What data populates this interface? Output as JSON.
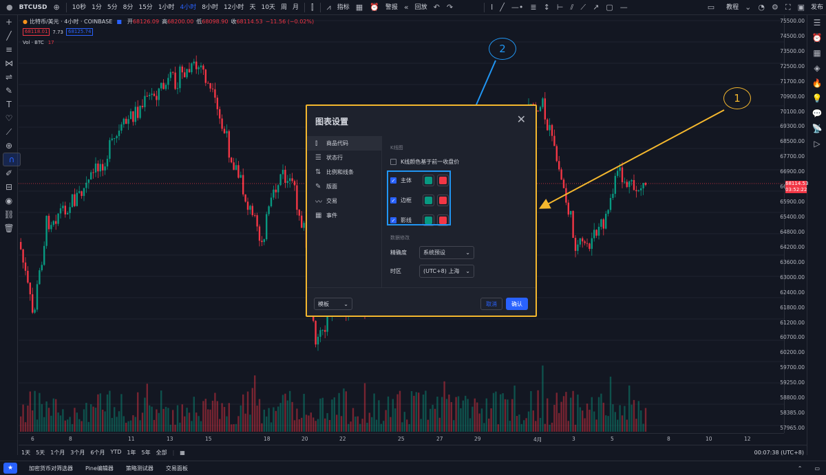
{
  "topbar": {
    "symbol": "BTCUSD",
    "intervals": [
      "10秒",
      "1分",
      "5分",
      "8分",
      "15分",
      "1小时",
      "4小时",
      "8小时",
      "12小时",
      "天",
      "10天",
      "周",
      "月"
    ],
    "active_interval": "4小时",
    "indicators_label": "指标",
    "alert_label": "警报",
    "replay_label": "回放",
    "tutorial_label": "教程",
    "publish_label": "发布"
  },
  "legend": {
    "title": "比特币/美元 · 4小时 · COINBASE",
    "open_label": "开",
    "open": "68126.09",
    "high_label": "高",
    "high": "68200.00",
    "low_label": "低",
    "low": "68098.90",
    "close_label": "收",
    "close": "68114.53",
    "change": "−11.56 (−0.02%)",
    "bid": "68118.01",
    "spread": "7.73",
    "ask": "68125.74",
    "volume_label": "Vol · BTC",
    "volume_value": "17"
  },
  "price_axis": {
    "labels": [
      "75500.00",
      "74500.00",
      "73500.00",
      "72500.00",
      "71700.00",
      "70900.00",
      "70100.00",
      "69300.00",
      "68500.00",
      "67700.00",
      "66900.00",
      "66400.00",
      "65900.00",
      "65400.00",
      "64800.00",
      "64200.00",
      "63600.00",
      "63000.00",
      "62400.00",
      "61800.00",
      "61200.00",
      "60700.00",
      "60200.00",
      "59700.00",
      "59250.00",
      "58800.00",
      "58385.00",
      "57965.00"
    ],
    "current_price": "68114.53",
    "countdown": "03:52:22"
  },
  "time_axis": {
    "labels": [
      "6",
      "8",
      "11",
      "13",
      "15",
      "18",
      "20",
      "22",
      "25",
      "27",
      "29",
      "4月",
      "3",
      "5",
      "8",
      "10",
      "12"
    ]
  },
  "range_bar": {
    "ranges": [
      "1天",
      "5天",
      "1个月",
      "3个月",
      "6个月",
      "YTD",
      "1年",
      "5年",
      "全部"
    ],
    "clock": "00:07:38 (UTC+8)"
  },
  "bottom_tabs": [
    "加密货币对筛选器",
    "Pine编辑器",
    "策略测试器",
    "交易面板"
  ],
  "dialog": {
    "title": "图表设置",
    "nav": [
      {
        "label": "商品代码",
        "icon": "candles-icon",
        "active": true
      },
      {
        "label": "状态行",
        "icon": "status-line-icon",
        "active": false
      },
      {
        "label": "比例和线条",
        "icon": "scales-icon",
        "active": false
      },
      {
        "label": "版面",
        "icon": "pencil-icon",
        "active": false
      },
      {
        "label": "交易",
        "icon": "trading-icon",
        "active": false
      },
      {
        "label": "事件",
        "icon": "calendar-icon",
        "active": false
      }
    ],
    "section_candles": "K线图",
    "prev_close_label": "K线颜色基于前一收盘价",
    "prev_close_checked": false,
    "rows": [
      {
        "label": "主体",
        "checked": true,
        "up_color": "#089981",
        "down_color": "#f23645"
      },
      {
        "label": "边框",
        "checked": true,
        "up_color": "#089981",
        "down_color": "#f23645"
      },
      {
        "label": "影线",
        "checked": true,
        "up_color": "#089981",
        "down_color": "#f23645"
      }
    ],
    "section_data": "数据修改",
    "precision_label": "精确度",
    "precision_value": "系统预设",
    "timezone_label": "时区",
    "timezone_value": "(UTC+8) 上海",
    "template_label": "模板",
    "cancel_label": "取消",
    "ok_label": "确认"
  },
  "annotations": {
    "callout_1": "1",
    "callout_2": "2",
    "callout_1_color": "#f5b82e",
    "callout_2_color": "#2196f3"
  },
  "colors": {
    "up": "#089981",
    "down": "#f23645",
    "accent": "#2962ff",
    "background": "#131722"
  }
}
